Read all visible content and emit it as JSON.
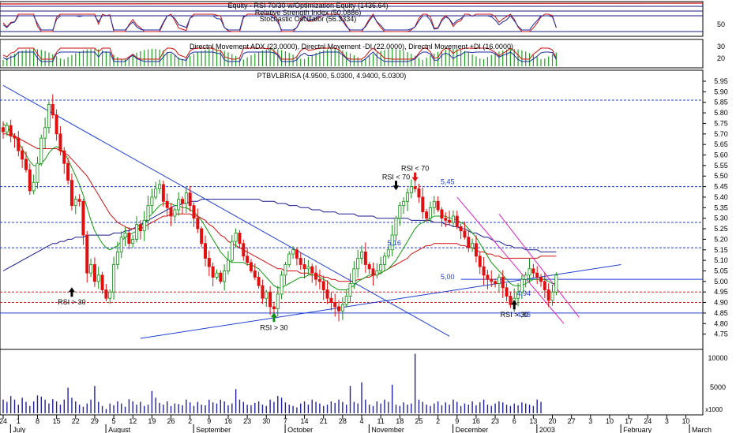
{
  "chart_data": {
    "type": "candlestick",
    "panels": {
      "equity": {
        "label": "Equity - RSI 70/30 w/Optimization Equity (1436.64)"
      },
      "rsi": {
        "label": "Relative Strength Index (50.0886)"
      },
      "stochastic": {
        "label": "Stochastic Oscillator (56.3334)",
        "yticks": [
          "50"
        ]
      },
      "dmi": {
        "label": "Directnl Movement ADX (23.0000), Directnl Movement -DI (22.0000), Directnl Movement +DI (16.0000)",
        "yticks": [
          "30",
          "20"
        ]
      },
      "price": {
        "label": "PTBVLBRISA (4.9500, 5.0300, 4.9400, 5.0300)",
        "ymin": 4.7,
        "ymax": 5.95,
        "yticks": [
          "5.95",
          "5.90",
          "5.85",
          "5.80",
          "5.75",
          "5.70",
          "5.65",
          "5.60",
          "5.55",
          "5.50",
          "5.45",
          "5.40",
          "5.35",
          "5.30",
          "5.25",
          "5.20",
          "5.15",
          "5.10",
          "5.05",
          "5.00",
          "4.95",
          "4.90",
          "4.85",
          "4.80",
          "4.75"
        ],
        "support_resistance": [
          5.86,
          5.45,
          5.28,
          5.16,
          4.95,
          4.9,
          4.85
        ],
        "level_labels": [
          {
            "text": "5,45",
            "value": 5.45
          },
          {
            "text": "5,16",
            "value": 5.16
          },
          {
            "text": "5,00",
            "value": 5.0
          },
          {
            "text": "4,94",
            "value": 4.92
          },
          {
            "text": "4,85",
            "value": 4.82
          }
        ],
        "annotations": [
          {
            "text": "RSI > 30",
            "index": 18,
            "value": 4.92,
            "arrow": "black"
          },
          {
            "text": "RSI > 30",
            "index": 71,
            "value": 4.8,
            "arrow": "green"
          },
          {
            "text": "RSI < 70",
            "index": 103,
            "value": 5.44,
            "arrow": "black"
          },
          {
            "text": "RSI < 70",
            "index": 108,
            "value": 5.48,
            "arrow": "red"
          },
          {
            "text": "RSI > 30",
            "index": 134,
            "value": 4.86,
            "arrow": "black"
          }
        ],
        "close": [
          5.71,
          5.74,
          5.69,
          5.68,
          5.62,
          5.58,
          5.53,
          5.43,
          5.47,
          5.56,
          5.68,
          5.73,
          5.84,
          5.79,
          5.7,
          5.62,
          5.56,
          5.48,
          5.36,
          5.39,
          5.38,
          5.22,
          5.04,
          5.08,
          5.0,
          5.03,
          4.96,
          4.92,
          4.95,
          5.08,
          5.14,
          5.21,
          5.23,
          5.18,
          5.2,
          5.27,
          5.24,
          5.29,
          5.36,
          5.4,
          5.44,
          5.46,
          5.38,
          5.35,
          5.31,
          5.34,
          5.39,
          5.37,
          5.42,
          5.36,
          5.3,
          5.25,
          5.18,
          5.11,
          5.07,
          5.02,
          5.04,
          5.0,
          5.05,
          5.1,
          5.19,
          5.23,
          5.18,
          5.12,
          5.09,
          5.05,
          5.02,
          4.98,
          4.92,
          4.95,
          4.88,
          4.87,
          4.94,
          5.03,
          5.08,
          5.13,
          5.15,
          5.11,
          5.08,
          5.06,
          5.07,
          5.04,
          5.01,
          5.0,
          4.96,
          4.92,
          4.9,
          4.88,
          4.86,
          4.89,
          4.93,
          4.99,
          5.06,
          5.11,
          5.14,
          5.08,
          5.06,
          5.03,
          5.05,
          5.08,
          5.12,
          5.15,
          5.22,
          5.3,
          5.36,
          5.38,
          5.42,
          5.45,
          5.44,
          5.4,
          5.33,
          5.3,
          5.35,
          5.38,
          5.34,
          5.3,
          5.29,
          5.28,
          5.31,
          5.26,
          5.24,
          5.21,
          5.16,
          5.18,
          5.12,
          5.07,
          5.03,
          5.01,
          5.0,
          4.99,
          5.02,
          4.97,
          4.93,
          4.89,
          4.92,
          4.95,
          5.01,
          5.03,
          5.06,
          5.04,
          5.02,
          5.0,
          4.96,
          4.91,
          4.95,
          5.03
        ],
        "ma_green": [
          5.75,
          5.73,
          5.71,
          5.69,
          5.66,
          5.63,
          5.6,
          5.57,
          5.55,
          5.55,
          5.56,
          5.58,
          5.61,
          5.63,
          5.64,
          5.63,
          5.61,
          5.58,
          5.54,
          5.5,
          5.46,
          5.41,
          5.35,
          5.29,
          5.24,
          5.21,
          5.18,
          5.16,
          5.15,
          5.16,
          5.17,
          5.19,
          5.21,
          5.22,
          5.23,
          5.24,
          5.26,
          5.28,
          5.3,
          5.32,
          5.34,
          5.36,
          5.37,
          5.37,
          5.37,
          5.36,
          5.36,
          5.35,
          5.35,
          5.34,
          5.33,
          5.31,
          5.29,
          5.26,
          5.23,
          5.2,
          5.17,
          5.14,
          5.12,
          5.1,
          5.09,
          5.09,
          5.09,
          5.09,
          5.08,
          5.08,
          5.07,
          5.06,
          5.04,
          5.02,
          5.0,
          4.98,
          4.97,
          4.97,
          4.98,
          4.99,
          5.0,
          5.01,
          5.02,
          5.02,
          5.03,
          5.03,
          5.03,
          5.02,
          5.01,
          5.0,
          4.98,
          4.97,
          4.96,
          4.96,
          4.96,
          4.97,
          4.98,
          5.0,
          5.01,
          5.02,
          5.03,
          5.03,
          5.04,
          5.04,
          5.05,
          5.06,
          5.08,
          5.1,
          5.13,
          5.16,
          5.19,
          5.22,
          5.25,
          5.27,
          5.28,
          5.29,
          5.3,
          5.31,
          5.31,
          5.31,
          5.31,
          5.3,
          5.3,
          5.29,
          5.28,
          5.27,
          5.25,
          5.23,
          5.21,
          5.18,
          5.15,
          5.12,
          5.09,
          5.07,
          5.05,
          5.03,
          5.01,
          4.99,
          4.98,
          4.98,
          4.98,
          4.99,
          5.0,
          5.01,
          5.01,
          5.01,
          5.01,
          5.0,
          4.99,
          4.99
        ],
        "ma_red": [
          5.7,
          5.7,
          5.69,
          5.69,
          5.68,
          5.67,
          5.66,
          5.65,
          5.64,
          5.63,
          5.63,
          5.63,
          5.63,
          5.63,
          5.63,
          5.62,
          5.61,
          5.6,
          5.58,
          5.56,
          5.54,
          5.52,
          5.5,
          5.47,
          5.44,
          5.41,
          5.38,
          5.35,
          5.32,
          5.3,
          5.28,
          5.27,
          5.26,
          5.25,
          5.25,
          5.25,
          5.25,
          5.26,
          5.27,
          5.28,
          5.29,
          5.3,
          5.31,
          5.31,
          5.32,
          5.32,
          5.32,
          5.32,
          5.32,
          5.32,
          5.31,
          5.31,
          5.3,
          5.29,
          5.27,
          5.26,
          5.24,
          5.22,
          5.21,
          5.19,
          5.18,
          5.17,
          5.16,
          5.15,
          5.14,
          5.13,
          5.12,
          5.11,
          5.1,
          5.09,
          5.08,
          5.07,
          5.06,
          5.06,
          5.05,
          5.05,
          5.05,
          5.05,
          5.04,
          5.04,
          5.04,
          5.03,
          5.03,
          5.03,
          5.02,
          5.02,
          5.01,
          5.01,
          5.0,
          5.0,
          5.0,
          5.0,
          5.0,
          5.01,
          5.01,
          5.02,
          5.02,
          5.03,
          5.03,
          5.04,
          5.05,
          5.06,
          5.07,
          5.08,
          5.09,
          5.1,
          5.11,
          5.13,
          5.14,
          5.15,
          5.16,
          5.17,
          5.17,
          5.18,
          5.18,
          5.18,
          5.18,
          5.18,
          5.18,
          5.18,
          5.17,
          5.17,
          5.16,
          5.16,
          5.15,
          5.14,
          5.14,
          5.13,
          5.13,
          5.12,
          5.12,
          5.11,
          5.11,
          5.11,
          5.11,
          5.11,
          5.11,
          5.11,
          5.11,
          5.11,
          5.11,
          5.12,
          5.12,
          5.12,
          5.12,
          5.12
        ],
        "ma_blue": [
          5.05,
          5.06,
          5.07,
          5.08,
          5.09,
          5.1,
          5.11,
          5.12,
          5.13,
          5.14,
          5.15,
          5.16,
          5.17,
          5.18,
          5.18,
          5.19,
          5.19,
          5.2,
          5.2,
          5.21,
          5.21,
          5.21,
          5.22,
          5.22,
          5.22,
          5.22,
          5.22,
          5.22,
          5.22,
          5.23,
          5.23,
          5.23,
          5.24,
          5.24,
          5.25,
          5.26,
          5.27,
          5.28,
          5.29,
          5.3,
          5.31,
          5.32,
          5.33,
          5.34,
          5.35,
          5.36,
          5.36,
          5.37,
          5.37,
          5.38,
          5.38,
          5.38,
          5.39,
          5.39,
          5.39,
          5.39,
          5.39,
          5.39,
          5.39,
          5.39,
          5.39,
          5.39,
          5.39,
          5.39,
          5.39,
          5.39,
          5.39,
          5.39,
          5.38,
          5.38,
          5.38,
          5.38,
          5.37,
          5.37,
          5.37,
          5.36,
          5.36,
          5.36,
          5.35,
          5.35,
          5.35,
          5.34,
          5.34,
          5.34,
          5.33,
          5.33,
          5.33,
          5.33,
          5.32,
          5.32,
          5.32,
          5.32,
          5.32,
          5.31,
          5.31,
          5.31,
          5.31,
          5.31,
          5.3,
          5.3,
          5.3,
          5.3,
          5.3,
          5.3,
          5.3,
          5.3,
          5.3,
          5.29,
          5.29,
          5.29,
          5.29,
          5.29,
          5.29,
          5.28,
          5.28,
          5.28,
          5.27,
          5.27,
          5.26,
          5.26,
          5.25,
          5.25,
          5.24,
          5.23,
          5.23,
          5.22,
          5.21,
          5.21,
          5.2,
          5.19,
          5.19,
          5.18,
          5.17,
          5.17,
          5.16,
          5.16,
          5.16,
          5.15,
          5.15,
          5.15,
          5.15,
          5.14,
          5.14,
          5.14,
          5.14,
          5.14
        ],
        "trendlines": [
          {
            "color": "#1f3fd0",
            "from": [
              0,
              5.93
            ],
            "to": [
              117,
              4.74
            ]
          },
          {
            "color": "#1f3fd0",
            "from": [
              36,
              4.73
            ],
            "to": [
              162,
              5.08
            ]
          },
          {
            "color": "#e020c0",
            "from": [
              119,
              5.4
            ],
            "to": [
              147,
              4.8
            ]
          },
          {
            "color": "#e020c0",
            "from": [
              130,
              5.32
            ],
            "to": [
              151,
              4.83
            ]
          }
        ]
      },
      "volume": {
        "yticks": [
          "10000",
          "5000"
        ],
        "unit": "x1000",
        "values": [
          300,
          250,
          400,
          300,
          200,
          350,
          250,
          180,
          260,
          420,
          380,
          300,
          220,
          310,
          260,
          200,
          300,
          780,
          350,
          260,
          200,
          170,
          220,
          300,
          900,
          250,
          180,
          140,
          220,
          190,
          260,
          220,
          170,
          310,
          260,
          200,
          250,
          180,
          200,
          600,
          350,
          230,
          200,
          260,
          180,
          220,
          210,
          190,
          300,
          240,
          180,
          250,
          200,
          190,
          300,
          240,
          220,
          300,
          260,
          190,
          220,
          700,
          300,
          250,
          200,
          190,
          230,
          260,
          200,
          180,
          300,
          250,
          400,
          350,
          240,
          200,
          180,
          160,
          220,
          260,
          200,
          300,
          250,
          220,
          180,
          200,
          260,
          230,
          300,
          250,
          200,
          900,
          250,
          220,
          1200,
          300,
          200,
          180,
          260,
          220,
          300,
          250,
          1000,
          200,
          180,
          240,
          200,
          220,
          12000,
          300,
          250,
          200,
          180,
          220,
          260,
          190,
          240,
          200,
          300,
          250,
          180,
          220,
          200,
          260,
          190,
          240,
          300,
          200,
          180,
          220,
          260,
          240,
          200,
          180,
          220,
          190,
          240,
          220,
          200,
          180,
          300,
          250
        ]
      }
    },
    "x_axis": {
      "day_labels": [
        {
          "text": "24",
          "index": 0
        },
        {
          "text": "1",
          "index": 4
        },
        {
          "text": "8",
          "index": 9
        },
        {
          "text": "15",
          "index": 14
        },
        {
          "text": "22",
          "index": 19
        },
        {
          "text": "29",
          "index": 24
        },
        {
          "text": "5",
          "index": 29
        },
        {
          "text": "12",
          "index": 34
        },
        {
          "text": "19",
          "index": 39
        },
        {
          "text": "26",
          "index": 44
        },
        {
          "text": "2",
          "index": 49
        },
        {
          "text": "9",
          "index": 54
        },
        {
          "text": "16",
          "index": 59
        },
        {
          "text": "23",
          "index": 64
        },
        {
          "text": "30",
          "index": 69
        },
        {
          "text": "7",
          "index": 74
        },
        {
          "text": "14",
          "index": 79
        },
        {
          "text": "21",
          "index": 84
        },
        {
          "text": "28",
          "index": 89
        },
        {
          "text": "4",
          "index": 94
        },
        {
          "text": "11",
          "index": 99
        },
        {
          "text": "18",
          "index": 104
        },
        {
          "text": "25",
          "index": 109
        },
        {
          "text": "2",
          "index": 114
        },
        {
          "text": "9",
          "index": 119
        },
        {
          "text": "16",
          "index": 124
        },
        {
          "text": "23",
          "index": 129
        },
        {
          "text": "6",
          "index": 134
        },
        {
          "text": "13",
          "index": 139
        },
        {
          "text": "20",
          "index": 144
        },
        {
          "text": "27",
          "index": 149
        },
        {
          "text": "3",
          "index": 154
        },
        {
          "text": "10",
          "index": 159
        },
        {
          "text": "17",
          "index": 164
        },
        {
          "text": "24",
          "index": 169
        },
        {
          "text": "3",
          "index": 174
        },
        {
          "text": "10",
          "index": 179
        }
      ],
      "month_labels": [
        {
          "text": "July",
          "index": 4
        },
        {
          "text": "August",
          "index": 29
        },
        {
          "text": "September",
          "index": 52
        },
        {
          "text": "October",
          "index": 76
        },
        {
          "text": "November",
          "index": 98
        },
        {
          "text": "December",
          "index": 120
        },
        {
          "text": "2003",
          "index": 142
        },
        {
          "text": "February",
          "index": 164
        },
        {
          "text": "March",
          "index": 182
        }
      ]
    }
  }
}
